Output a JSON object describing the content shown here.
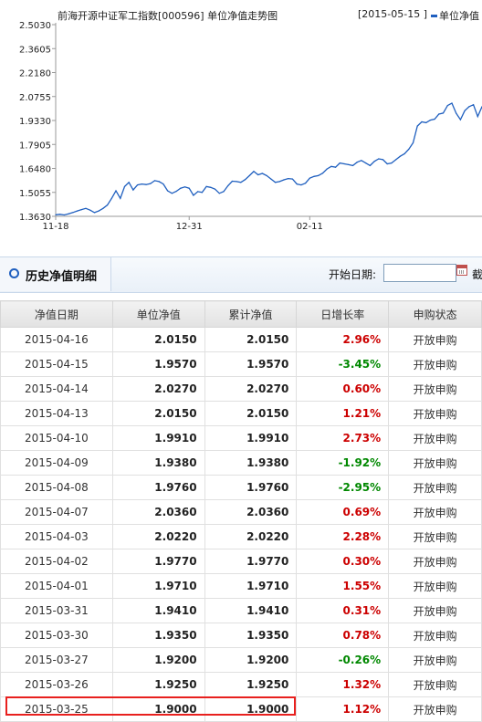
{
  "chart": {
    "title": "前海开源中证军工指数[000596] 单位净值走势图",
    "date_range": "[2015-05-15 ]",
    "legend_label": "单位净值",
    "colors": {
      "line": "#1f5fbf",
      "axis": "#999999"
    }
  },
  "chart_data": {
    "type": "line",
    "title": "前海开源中证军工指数[000596] 单位净值走势图",
    "xlabel": "",
    "ylabel": "",
    "ylim": [
      1.363,
      2.503
    ],
    "yticks": [
      "2.5030",
      "2.3605",
      "2.2180",
      "2.0755",
      "1.9330",
      "1.7905",
      "1.6480",
      "1.5055",
      "1.3630"
    ],
    "xticks": [
      "11-18",
      "12-31",
      "02-11"
    ],
    "series": [
      {
        "name": "单位净值",
        "x": [
          "11-18",
          "11-19",
          "11-20",
          "11-21",
          "11-24",
          "11-25",
          "11-26",
          "11-27",
          "11-28",
          "12-01",
          "12-02",
          "12-03",
          "12-04",
          "12-05",
          "12-08",
          "12-09",
          "12-10",
          "12-11",
          "12-12",
          "12-15",
          "12-16",
          "12-17",
          "12-18",
          "12-19",
          "12-22",
          "12-23",
          "12-24",
          "12-25",
          "12-26",
          "12-29",
          "12-30",
          "12-31",
          "01-05",
          "01-06",
          "01-07",
          "01-08",
          "01-09",
          "01-12",
          "01-13",
          "01-14",
          "01-15",
          "01-16",
          "01-19",
          "01-20",
          "01-21",
          "01-22",
          "01-23",
          "01-26",
          "01-27",
          "01-28",
          "01-29",
          "01-30",
          "02-02",
          "02-03",
          "02-04",
          "02-05",
          "02-06",
          "02-09",
          "02-10",
          "02-11",
          "02-12",
          "02-13",
          "02-16",
          "02-17",
          "02-25",
          "02-26",
          "02-27",
          "03-02",
          "03-03",
          "03-04",
          "03-05",
          "03-06",
          "03-09",
          "03-10",
          "03-11",
          "03-12",
          "03-13",
          "03-16",
          "03-17",
          "03-18",
          "03-19",
          "03-20",
          "03-23",
          "03-24",
          "03-25",
          "03-26",
          "03-27",
          "03-30",
          "03-31",
          "04-01",
          "04-02",
          "04-03",
          "04-07",
          "04-08",
          "04-09",
          "04-10",
          "04-13",
          "04-14",
          "04-15",
          "04-16"
        ],
        "values": [
          1.372,
          1.375,
          1.371,
          1.378,
          1.386,
          1.395,
          1.403,
          1.41,
          1.4,
          1.385,
          1.395,
          1.41,
          1.43,
          1.47,
          1.515,
          1.47,
          1.54,
          1.565,
          1.52,
          1.55,
          1.555,
          1.552,
          1.558,
          1.575,
          1.57,
          1.555,
          1.515,
          1.5,
          1.512,
          1.53,
          1.538,
          1.53,
          1.488,
          1.51,
          1.505,
          1.54,
          1.535,
          1.525,
          1.5,
          1.51,
          1.545,
          1.572,
          1.57,
          1.565,
          1.582,
          1.605,
          1.63,
          1.61,
          1.618,
          1.605,
          1.585,
          1.565,
          1.57,
          1.58,
          1.588,
          1.585,
          1.555,
          1.55,
          1.56,
          1.59,
          1.6,
          1.605,
          1.62,
          1.645,
          1.66,
          1.655,
          1.68,
          1.675,
          1.67,
          1.665,
          1.685,
          1.695,
          1.68,
          1.665,
          1.69,
          1.705,
          1.7,
          1.675,
          1.68,
          1.7,
          1.72,
          1.735,
          1.762,
          1.8,
          1.9,
          1.925,
          1.92,
          1.935,
          1.941,
          1.971,
          1.977,
          2.022,
          2.036,
          1.976,
          1.938,
          1.991,
          2.015,
          2.027,
          1.957,
          2.015
        ],
        "visible_window_note": ""
      }
    ]
  },
  "section": {
    "title": "历史净值明细",
    "start_date_label": "开始日期:",
    "start_date_value": "",
    "search_label": "截"
  },
  "table": {
    "headers": [
      "净值日期",
      "单位净值",
      "累计净值",
      "日增长率",
      "申购状态"
    ],
    "rows": [
      {
        "date": "2015-04-16",
        "nav": "2.0150",
        "acc": "2.0150",
        "pct": "2.96%",
        "dir": "up",
        "status": "开放申购"
      },
      {
        "date": "2015-04-15",
        "nav": "1.9570",
        "acc": "1.9570",
        "pct": "-3.45%",
        "dir": "down",
        "status": "开放申购"
      },
      {
        "date": "2015-04-14",
        "nav": "2.0270",
        "acc": "2.0270",
        "pct": "0.60%",
        "dir": "up",
        "status": "开放申购"
      },
      {
        "date": "2015-04-13",
        "nav": "2.0150",
        "acc": "2.0150",
        "pct": "1.21%",
        "dir": "up",
        "status": "开放申购"
      },
      {
        "date": "2015-04-10",
        "nav": "1.9910",
        "acc": "1.9910",
        "pct": "2.73%",
        "dir": "up",
        "status": "开放申购"
      },
      {
        "date": "2015-04-09",
        "nav": "1.9380",
        "acc": "1.9380",
        "pct": "-1.92%",
        "dir": "down",
        "status": "开放申购"
      },
      {
        "date": "2015-04-08",
        "nav": "1.9760",
        "acc": "1.9760",
        "pct": "-2.95%",
        "dir": "down",
        "status": "开放申购"
      },
      {
        "date": "2015-04-07",
        "nav": "2.0360",
        "acc": "2.0360",
        "pct": "0.69%",
        "dir": "up",
        "status": "开放申购"
      },
      {
        "date": "2015-04-03",
        "nav": "2.0220",
        "acc": "2.0220",
        "pct": "2.28%",
        "dir": "up",
        "status": "开放申购"
      },
      {
        "date": "2015-04-02",
        "nav": "1.9770",
        "acc": "1.9770",
        "pct": "0.30%",
        "dir": "up",
        "status": "开放申购"
      },
      {
        "date": "2015-04-01",
        "nav": "1.9710",
        "acc": "1.9710",
        "pct": "1.55%",
        "dir": "up",
        "status": "开放申购"
      },
      {
        "date": "2015-03-31",
        "nav": "1.9410",
        "acc": "1.9410",
        "pct": "0.31%",
        "dir": "up",
        "status": "开放申购"
      },
      {
        "date": "2015-03-30",
        "nav": "1.9350",
        "acc": "1.9350",
        "pct": "0.78%",
        "dir": "up",
        "status": "开放申购"
      },
      {
        "date": "2015-03-27",
        "nav": "1.9200",
        "acc": "1.9200",
        "pct": "-0.26%",
        "dir": "down",
        "status": "开放申购"
      },
      {
        "date": "2015-03-26",
        "nav": "1.9250",
        "acc": "1.9250",
        "pct": "1.32%",
        "dir": "up",
        "status": "开放申购"
      },
      {
        "date": "2015-03-25",
        "nav": "1.9000",
        "acc": "1.9000",
        "pct": "1.12%",
        "dir": "up",
        "status": "开放申购"
      }
    ]
  }
}
